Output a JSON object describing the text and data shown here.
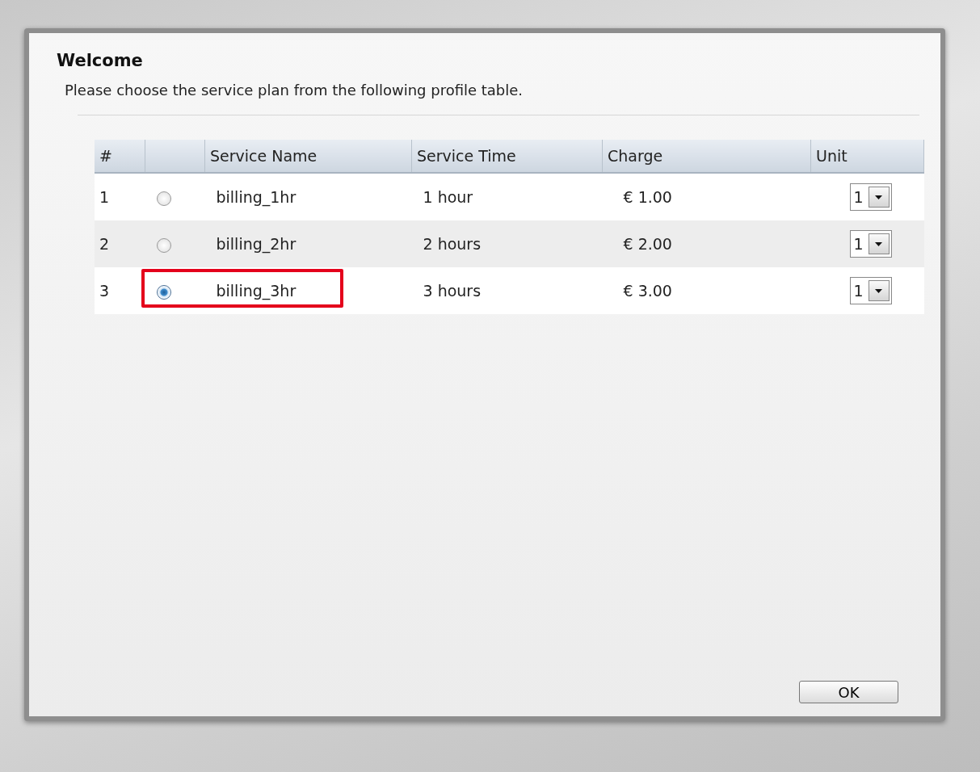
{
  "dialog": {
    "title": "Welcome",
    "subtitle": "Please choose the service plan from the following profile table."
  },
  "table": {
    "columns": [
      "#",
      "",
      "Service Name",
      "Service Time",
      "Charge",
      "Unit"
    ],
    "rows": [
      {
        "number": "1",
        "selected": false,
        "highlighted": false,
        "service_name": "billing_1hr",
        "service_time": "1 hour",
        "charge": "€ 1.00",
        "unit": "1"
      },
      {
        "number": "2",
        "selected": false,
        "highlighted": false,
        "service_name": "billing_2hr",
        "service_time": "2 hours",
        "charge": "€ 2.00",
        "unit": "1"
      },
      {
        "number": "3",
        "selected": true,
        "highlighted": true,
        "service_name": "billing_3hr",
        "service_time": "3 hours",
        "charge": "€ 3.00",
        "unit": "1"
      }
    ]
  },
  "buttons": [
    "OK"
  ]
}
